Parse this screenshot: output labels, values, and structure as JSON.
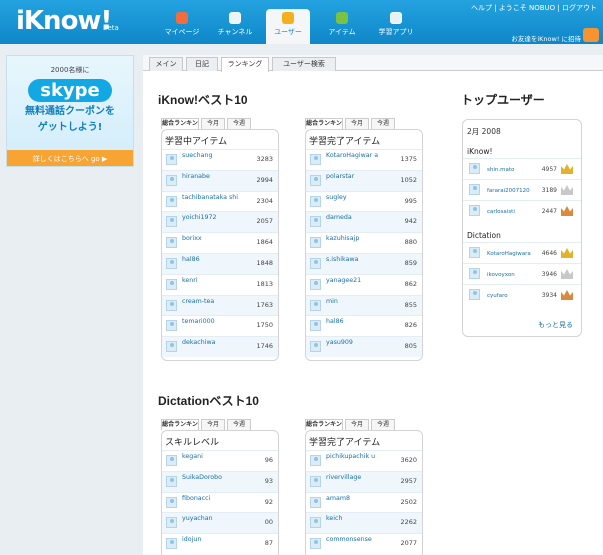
{
  "header": {
    "logo": "iKnow!",
    "beta": "beta",
    "nav": [
      "マイページ",
      "チャンネル",
      "ユーザー",
      "アイテム",
      "学習アプリ"
    ],
    "top_links": "ヘルプ | ようこそ NOBUO | ログアウト",
    "invite": "お友達をiKnow! に招待"
  },
  "ad": {
    "line1": "2000名様に",
    "brand": "skype",
    "line2": "無料通話クーポンを",
    "line3": "ゲットしよう!",
    "cta": "詳しくはこちらへ go ▶"
  },
  "tabs": [
    "メイン",
    "日記",
    "ランキング",
    "ユーザー検索"
  ],
  "range_tabs": [
    "総合ランキング",
    "今月",
    "今週"
  ],
  "sections": [
    {
      "title": "iKnow!ベスト10",
      "boxes": [
        {
          "title": "学習中アイテム",
          "rows": [
            {
              "name": "suechang",
              "score": "3283"
            },
            {
              "name": "hiranabe",
              "score": "2994"
            },
            {
              "name": "tachibanataka shi",
              "score": "2304"
            },
            {
              "name": "yoichi1972",
              "score": "2057"
            },
            {
              "name": "borixx",
              "score": "1864"
            },
            {
              "name": "hal86",
              "score": "1848"
            },
            {
              "name": "kenri",
              "score": "1813"
            },
            {
              "name": "cream-tea",
              "score": "1763"
            },
            {
              "name": "temari000",
              "score": "1750"
            },
            {
              "name": "dekachiwa",
              "score": "1746"
            }
          ]
        },
        {
          "title": "学習完了アイテム",
          "rows": [
            {
              "name": "KotaroHagiwar a",
              "score": "1375"
            },
            {
              "name": "polarstar",
              "score": "1052"
            },
            {
              "name": "sugley",
              "score": "995"
            },
            {
              "name": "dameda",
              "score": "942"
            },
            {
              "name": "kazuhisajp",
              "score": "880"
            },
            {
              "name": "s.ishikawa",
              "score": "859"
            },
            {
              "name": "yanagee21",
              "score": "862"
            },
            {
              "name": "min",
              "score": "855"
            },
            {
              "name": "hal86",
              "score": "826"
            },
            {
              "name": "yasu909",
              "score": "805"
            }
          ]
        }
      ]
    },
    {
      "title": "Dictationベスト10",
      "boxes": [
        {
          "title": "スキルレベル",
          "rows": [
            {
              "name": "kegani",
              "score": "96"
            },
            {
              "name": "SuikaDorobo",
              "score": "93"
            },
            {
              "name": "fibonacci",
              "score": "92"
            },
            {
              "name": "yuyachan",
              "score": "00"
            },
            {
              "name": "idojun",
              "score": "87"
            }
          ]
        },
        {
          "title": "学習完了アイテム",
          "rows": [
            {
              "name": "pichikupachik u",
              "score": "3620"
            },
            {
              "name": "rivervillage",
              "score": "2957"
            },
            {
              "name": "amam8",
              "score": "2502"
            },
            {
              "name": "keich",
              "score": "2262"
            },
            {
              "name": "commonsense",
              "score": "2077"
            }
          ]
        }
      ]
    }
  ],
  "top_users": {
    "title": "トップユーザー",
    "date": "2月 2008",
    "groups": [
      {
        "label": "iKnow!",
        "rows": [
          {
            "name": "shin.mato",
            "score": "4957",
            "medal": "gold"
          },
          {
            "name": "fararai2007120",
            "score": "3189",
            "medal": "silver"
          },
          {
            "name": "carlosaisti",
            "score": "2447",
            "medal": "bronze"
          }
        ]
      },
      {
        "label": "Dictation",
        "rows": [
          {
            "name": "KotaroHagiwara",
            "score": "4646",
            "medal": "gold"
          },
          {
            "name": "ikovoyxon",
            "score": "3946",
            "medal": "silver"
          },
          {
            "name": "cyufaro",
            "score": "3934",
            "medal": "bronze"
          }
        ]
      }
    ],
    "more": "もっと見る"
  }
}
